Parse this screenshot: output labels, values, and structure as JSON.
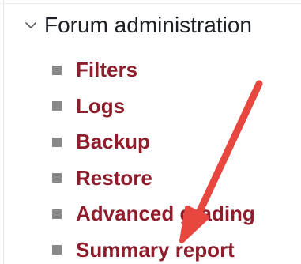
{
  "section": {
    "title": "Forum administration",
    "icon": "chevron-down-icon"
  },
  "menu": {
    "items": [
      {
        "label": "Filters"
      },
      {
        "label": "Logs"
      },
      {
        "label": "Backup"
      },
      {
        "label": "Restore"
      },
      {
        "label": "Advanced grading"
      },
      {
        "label": "Summary report"
      }
    ]
  },
  "colors": {
    "link": "#8f1d2b",
    "bullet": "#8a8a8a",
    "arrow": "#e8473f",
    "heading": "#1d2125"
  }
}
